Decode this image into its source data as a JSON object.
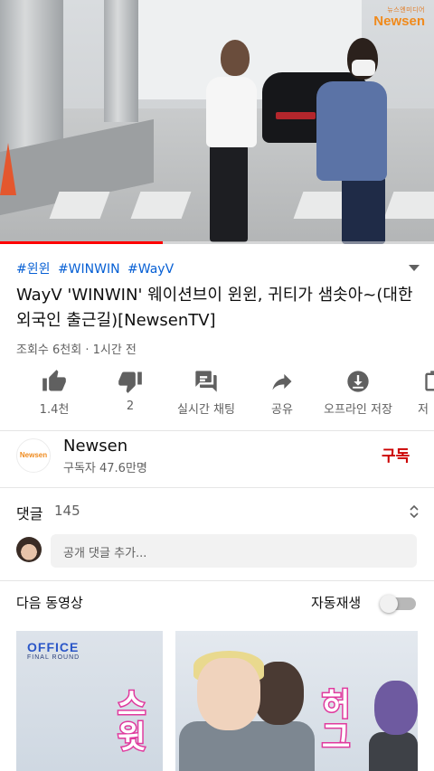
{
  "player": {
    "watermark_small": "뉴스엔미디어",
    "watermark_main": "Newsen",
    "progress": 0.375
  },
  "video": {
    "hashtags": [
      "#윈윈",
      "#WINWIN",
      "#WayV"
    ],
    "title": "WayV 'WINWIN' 웨이션브이 윈윈, 귀티가 샘솟아~(대한외국인 출근길)[NewsenTV]",
    "meta": "조회수 6천회 · 1시간 전"
  },
  "actions": [
    {
      "label": "1.4천",
      "icon": "thumbs-up-icon"
    },
    {
      "label": "2",
      "icon": "thumbs-down-icon"
    },
    {
      "label": "실시간 채팅",
      "icon": "live-chat-icon"
    },
    {
      "label": "공유",
      "icon": "share-icon"
    },
    {
      "label": "오프라인 저장",
      "icon": "download-icon"
    },
    {
      "label": "저",
      "icon": "save-playlist-icon"
    }
  ],
  "channel": {
    "avatar_text": "Newsen",
    "name": "Newsen",
    "subscribers": "구독자 47.6만명",
    "subscribe_label": "구독",
    "subscribe_color": "#cc0000"
  },
  "comments": {
    "title": "댓글",
    "count": "145",
    "placeholder": "공개 댓글 추가..."
  },
  "up_next": {
    "title": "다음 동영상",
    "autoplay_label": "자동재생",
    "autoplay_on": false,
    "thumbnail": {
      "brand": "OFFICE",
      "subtitle": "FINAL ROUND",
      "text_left": "스윗",
      "text_right": "허그"
    }
  },
  "colors": {
    "link": "#065fd4",
    "progress": "#ff0000",
    "brand_orange": "#f08a1c"
  }
}
